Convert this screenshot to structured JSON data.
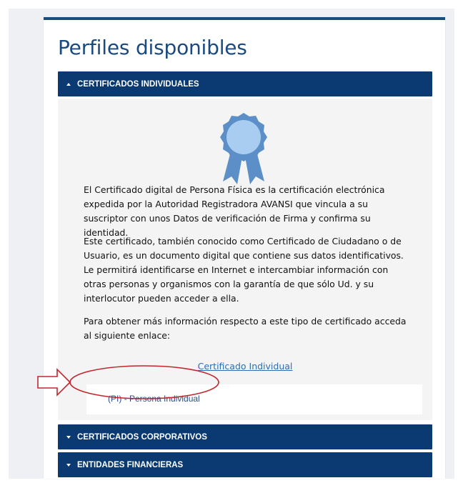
{
  "page": {
    "title": "Perfiles disponibles"
  },
  "accordion": {
    "individuales": {
      "label": "CERTIFICADOS INDIVIDUALES",
      "expanded": true,
      "paragraphs": [
        "El Certificado digital de Persona Física es la certificación electrónica expedida por la Autoridad Registradora AVANSI que vincula a su suscriptor con unos Datos de verificación de Firma y confirma su identidad.",
        "Este certificado, también conocido como Certificado de Ciudadano o de Usuario, es un documento digital que contiene sus datos identificativos. Le permitirá identificarse en Internet e intercambiar información con otras personas y organismos con la garantía de que sólo Ud. y su interlocutor pueden acceder a ella.",
        "Para obtener más información respecto a este tipo de certificado acceda al siguiente enlace:"
      ],
      "link_text": "Certificado Individual",
      "profile_option": "(PI) - Persona Individual"
    },
    "corporativos": {
      "label": "CERTIFICADOS CORPORATIVOS",
      "expanded": false
    },
    "financieras": {
      "label": "ENTIDADES FINANCIERAS",
      "expanded": false
    }
  },
  "icons": {
    "header_expanded": "caret-up-icon",
    "header_collapsed": "caret-down-icon",
    "certificate": "award-ribbon-icon",
    "annotation_arrow": "arrow-right-outline-icon"
  },
  "colors": {
    "brand_blue": "#0b3a72",
    "title_blue": "#1b4a7e",
    "link_blue": "#2f6db3",
    "ribbon_light": "#a9cdf0",
    "ribbon_dark": "#5c8fc7",
    "annotation_red": "#c0282d"
  }
}
